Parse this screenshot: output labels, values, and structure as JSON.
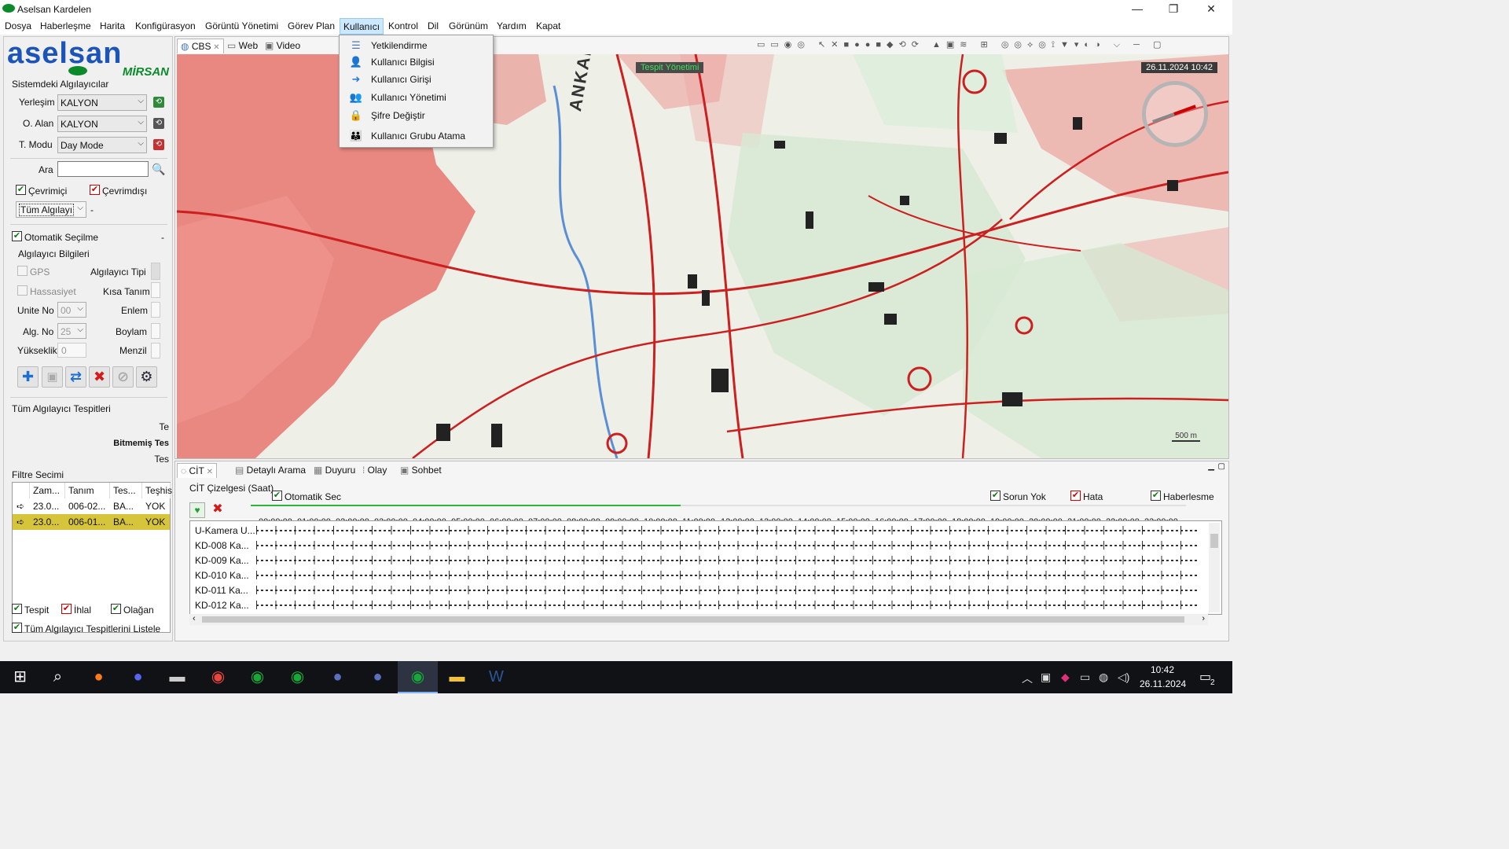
{
  "window": {
    "title": "Aselsan Kardelen",
    "controls": {
      "minimize": "—",
      "restore": "❐",
      "close": "✕"
    }
  },
  "menubar": [
    "Dosya",
    "Haberleşme",
    "Harita",
    "Konfigürasyon",
    "Görüntü Yönetimi",
    "Görev Plan",
    "Kullanıcı",
    "Kontrol",
    "Dil",
    "Görünüm",
    "Yardım",
    "Kapat"
  ],
  "menubar_active": "Kullanıcı",
  "user_menu": [
    {
      "label": "Yetkilendirme",
      "icon": "list-icon"
    },
    {
      "label": "Kullanıcı Bilgisi",
      "icon": "user-info-icon"
    },
    {
      "label": "Kullanıcı Girişi",
      "icon": "login-arrow-icon"
    },
    {
      "label": "Kullanıcı Yönetimi",
      "icon": "user-add-icon"
    },
    {
      "label": "Şifre Değiştir",
      "icon": "lock-icon"
    },
    {
      "label": "Kullanıcı Grubu Atama",
      "icon": "user-group-icon"
    }
  ],
  "logo": {
    "top": "aselsan",
    "bottom": "MİRSAN"
  },
  "sensors": {
    "section_title": "Sistemdeki Algılayıcılar",
    "yerlesim_label": "Yerleşim",
    "yerlesim_value": "KALYON",
    "oalan_label": "O. Alan",
    "oalan_value": "KALYON",
    "tmodu_label": "T. Modu",
    "tmodu_value": "Day Mode",
    "search_label": "Ara",
    "search_value": "",
    "online_label": "Çevrimiçi",
    "online_checked": true,
    "offline_label": "Çevrimdışı",
    "offline_checked": true,
    "filter_value": "Tüm Algılayı",
    "filter_suffix": "-",
    "auto_select_label": "Otomatik Seçilme",
    "auto_select_checked": true,
    "auto_select_suffix": "-",
    "info_title": "Algılayıcı Bilgileri",
    "gps_label": "GPS",
    "sensor_type_label": "Algılayıcı Tipi",
    "sensitivity_label": "Hassasiyet",
    "short_def_label": "Kısa Tanım",
    "unit_no_label": "Unite No",
    "unit_no_value": "00",
    "lat_label": "Enlem",
    "alg_no_label": "Alg. No",
    "alg_no_value": "25",
    "lon_label": "Boylam",
    "altitude_label": "Yükseklik",
    "altitude_value": "0",
    "range_label": "Menzil"
  },
  "detections": {
    "title": "Tüm Algılayıcı Tespitleri",
    "line1": "Te",
    "line2": "Bitmemiş Tes",
    "line3": "Tes"
  },
  "filter": {
    "title": "Filtre Secimi",
    "columns": [
      "Zam...",
      "Tanım",
      "Tes...",
      "Teşhis"
    ],
    "rows": [
      {
        "time": "23.0...",
        "def": "006-02...",
        "det": "BA...",
        "diag": "YOK",
        "selected": false
      },
      {
        "time": "23.0...",
        "def": "006-01...",
        "det": "BA...",
        "diag": "YOK",
        "selected": true
      }
    ],
    "tespit_label": "Tespit",
    "ihlal_label": "İhlal",
    "olagan_label": "Olağan",
    "list_all_label": "Tüm Algılayıcı Tespitlerini Listele"
  },
  "map_tabs": [
    {
      "label": "CBS",
      "closable": true
    },
    {
      "label": "Web"
    },
    {
      "label": "Video"
    }
  ],
  "map": {
    "banner": "Tespit Yönetimi",
    "datetime": "26.11.2024 10:42",
    "city_label": "ANKARA",
    "scale": "500 m",
    "colors": {
      "urban": "#e8746e",
      "road": "#cc2020",
      "green": "#d7e9d3",
      "base": "#eef0e8"
    }
  },
  "bottom_tabs": [
    {
      "label": "CİT",
      "closable": true
    },
    {
      "label": "Detaylı Arama"
    },
    {
      "label": "Duyuru"
    },
    {
      "label": "Olay"
    },
    {
      "label": "Sohbet"
    }
  ],
  "timeline": {
    "title": "CİT Çizelgesi (Saat)",
    "auto_label": "Otomatik Sec",
    "progress": 0.46,
    "legend": [
      {
        "label": "Sorun Yok",
        "color": "#0a7a0a"
      },
      {
        "label": "Hata",
        "color": "#c00000"
      },
      {
        "label": "Haberlesme",
        "color": "#0a7a0a"
      }
    ],
    "hours": [
      "00:00:00",
      "01:00:00",
      "02:00:00",
      "03:00:00",
      "04:00:00",
      "05:00:00",
      "06:00:00",
      "07:00:00",
      "08:00:00",
      "09:00:00",
      "10:00:00",
      "11:00:00",
      "12:00:00",
      "13:00:00",
      "14:00:00",
      "15:00:00",
      "16:00:00",
      "17:00:00",
      "18:00:00",
      "19:00:00",
      "20:00:00",
      "21:00:00",
      "22:00:00",
      "23:00:00"
    ],
    "rows": [
      "U-Kamera U...",
      "KD-008 Ka...",
      "KD-009 Ka...",
      "KD-010 Ka...",
      "KD-011 Ka...",
      "KD-012 Ka..."
    ]
  },
  "taskbar": {
    "time": "10:42",
    "date": "26.11.2024",
    "notification_count": "2",
    "apps": [
      "start-icon",
      "search-icon",
      "firefox-icon",
      "discord-icon",
      "terminal-icon",
      "chrome-icon",
      "kardelen-icon",
      "kardelen-icon",
      "eclipse-icon",
      "eclipse-icon",
      "kardelen-active-icon",
      "explorer-icon",
      "word-icon"
    ]
  }
}
